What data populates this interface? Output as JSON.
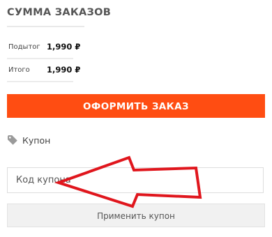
{
  "order_summary": {
    "title": "СУММА ЗАКАЗОВ",
    "rows": [
      {
        "label": "Подытог",
        "value": "1,990 ₽"
      },
      {
        "label": "Итого",
        "value": "1,990 ₽"
      }
    ]
  },
  "checkout": {
    "button_label": "ОФОРМИТЬ ЗАКАЗ"
  },
  "coupon": {
    "heading": "Купон",
    "input_placeholder": "Код купона",
    "input_value": "",
    "apply_label": "Применить купон"
  },
  "colors": {
    "accent": "#ff4d12",
    "annotation_arrow": "#e0161d"
  },
  "icons": {
    "coupon": "tag-icon",
    "annotation": "arrow-left-icon"
  }
}
